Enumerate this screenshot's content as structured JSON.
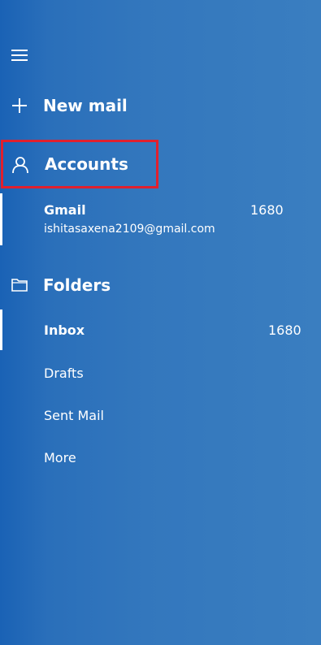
{
  "nav": {
    "menu_icon": "hamburger-icon",
    "new_mail_label": "New mail",
    "new_mail_icon": "plus-icon"
  },
  "accounts": {
    "heading": "Accounts",
    "icon": "person-icon",
    "highlight_color": "#e0202e",
    "items": [
      {
        "name": "Gmail",
        "email": "ishitasaxena2109@gmail.com",
        "unread": "1680"
      }
    ]
  },
  "folders": {
    "heading": "Folders",
    "icon": "folder-icon",
    "items": [
      {
        "name": "Inbox",
        "unread": "1680",
        "selected": true
      },
      {
        "name": "Drafts"
      },
      {
        "name": "Sent Mail"
      },
      {
        "name": "More"
      }
    ]
  },
  "colors": {
    "pane_background": "#2f72bc",
    "text": "#ffffff",
    "accent_bar": "#ffffff"
  }
}
